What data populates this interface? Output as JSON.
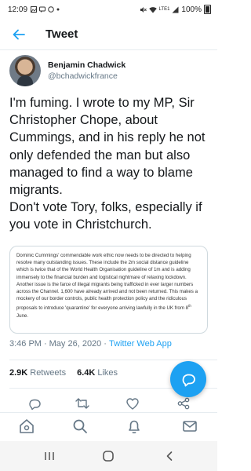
{
  "status_bar": {
    "time": "12:09",
    "network": "LTE1",
    "battery": "100%"
  },
  "header": {
    "title": "Tweet"
  },
  "tweet": {
    "author_name": "Benjamin Chadwick",
    "author_handle": "@bchadwickfrance",
    "text_lines": [
      "I'm fuming. I wrote to my MP, Sir Christopher Chope, about Cummings, and in his reply he not only defended the man but also managed to find a way to blame migrants.",
      "Don't vote Tory, folks, especially if you vote in Christchurch."
    ],
    "quote_text_main": "Dominic Cummings' commendable work ethic now needs to be directed to helping resolve many outstanding issues.  These include the 2m social distance guideline which is twice that of the World Health Organisation guideline of 1m and is adding immensely to the financial burden and logistical nightmare of relaxing lockdown.  Another issue is the farce of illegal migrants being trafficked in ever larger numbers across the Channel.  1,600 have already arrived and not been returned.  This makes a mockery of our border controls, public health protection policy and the ridiculous proposals to introduce 'quarantine' for everyone arriving lawfully in the UK from 8",
    "quote_sup": "th",
    "quote_text_end": " June.",
    "time": "3:46 PM",
    "separator": "·",
    "date": "May 26, 2020",
    "source": "Twitter Web App",
    "retweets_count": "2.9K",
    "retweets_label": "Retweets",
    "likes_count": "6.4K",
    "likes_label": "Likes"
  },
  "icons": {
    "back": "arrow-left-icon",
    "reply": "reply-icon",
    "retweet": "retweet-icon",
    "like": "heart-icon",
    "share": "share-icon",
    "compose": "compose-icon",
    "home": "home-icon",
    "search": "search-icon",
    "notifications": "bell-icon",
    "messages": "mail-icon"
  },
  "colors": {
    "accent": "#1da1f2",
    "text": "#14171a",
    "secondary": "#657786"
  }
}
